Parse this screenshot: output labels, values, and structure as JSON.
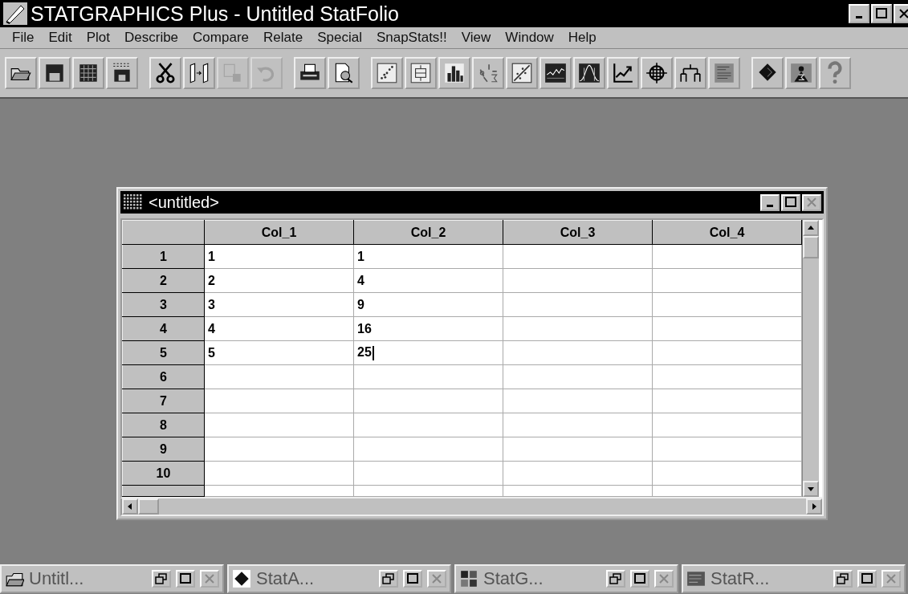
{
  "window": {
    "title": "STATGRAPHICS Plus - Untitled StatFolio"
  },
  "menu": [
    "File",
    "Edit",
    "Plot",
    "Describe",
    "Compare",
    "Relate",
    "Special",
    "SnapStats!!",
    "View",
    "Window",
    "Help"
  ],
  "toolbar": [
    {
      "kind": "open",
      "disabled": false
    },
    {
      "kind": "save",
      "disabled": false
    },
    {
      "kind": "grid",
      "disabled": false
    },
    {
      "kind": "numbers",
      "disabled": false
    },
    {
      "kind": "cut",
      "disabled": false
    },
    {
      "kind": "copy",
      "disabled": false
    },
    {
      "kind": "paste",
      "disabled": true
    },
    {
      "kind": "undo",
      "disabled": true
    },
    {
      "kind": "print",
      "disabled": false
    },
    {
      "kind": "preview",
      "disabled": false
    },
    {
      "kind": "scatter",
      "disabled": false
    },
    {
      "kind": "boxplot",
      "disabled": false
    },
    {
      "kind": "histogram",
      "disabled": false
    },
    {
      "kind": "stats",
      "disabled": false
    },
    {
      "kind": "regression",
      "disabled": false
    },
    {
      "kind": "timeseries",
      "disabled": false
    },
    {
      "kind": "distribution",
      "disabled": false
    },
    {
      "kind": "trend",
      "disabled": false
    },
    {
      "kind": "target",
      "disabled": false
    },
    {
      "kind": "tree",
      "disabled": false
    },
    {
      "kind": "report",
      "disabled": false
    },
    {
      "kind": "diamond",
      "disabled": false
    },
    {
      "kind": "advisor",
      "disabled": false
    },
    {
      "kind": "help",
      "disabled": false
    }
  ],
  "data_window": {
    "title": "<untitled>",
    "columns": [
      "Col_1",
      "Col_2",
      "Col_3",
      "Col_4"
    ],
    "rows": [
      {
        "label": "1",
        "cells": [
          {
            "value": "1",
            "editing": false
          },
          {
            "value": "1",
            "editing": false
          }
        ]
      },
      {
        "label": "2",
        "cells": [
          {
            "value": "2",
            "editing": false
          },
          {
            "value": "4",
            "editing": false
          }
        ]
      },
      {
        "label": "3",
        "cells": [
          {
            "value": "3",
            "editing": false
          },
          {
            "value": "9",
            "editing": false
          }
        ]
      },
      {
        "label": "4",
        "cells": [
          {
            "value": "4",
            "editing": false
          },
          {
            "value": "16",
            "editing": false
          }
        ]
      },
      {
        "label": "5",
        "cells": [
          {
            "value": "5",
            "editing": false
          },
          {
            "value": "25",
            "editing": true
          }
        ]
      },
      {
        "label": "6",
        "cells": []
      },
      {
        "label": "7",
        "cells": []
      },
      {
        "label": "8",
        "cells": []
      },
      {
        "label": "9",
        "cells": []
      },
      {
        "label": "10",
        "cells": []
      }
    ]
  },
  "minimized_windows": [
    {
      "title": "Untitl...",
      "kind": "folio"
    },
    {
      "title": "StatA...",
      "kind": "advisor"
    },
    {
      "title": "StatG...",
      "kind": "gallery"
    },
    {
      "title": "StatR...",
      "kind": "reporter"
    }
  ]
}
